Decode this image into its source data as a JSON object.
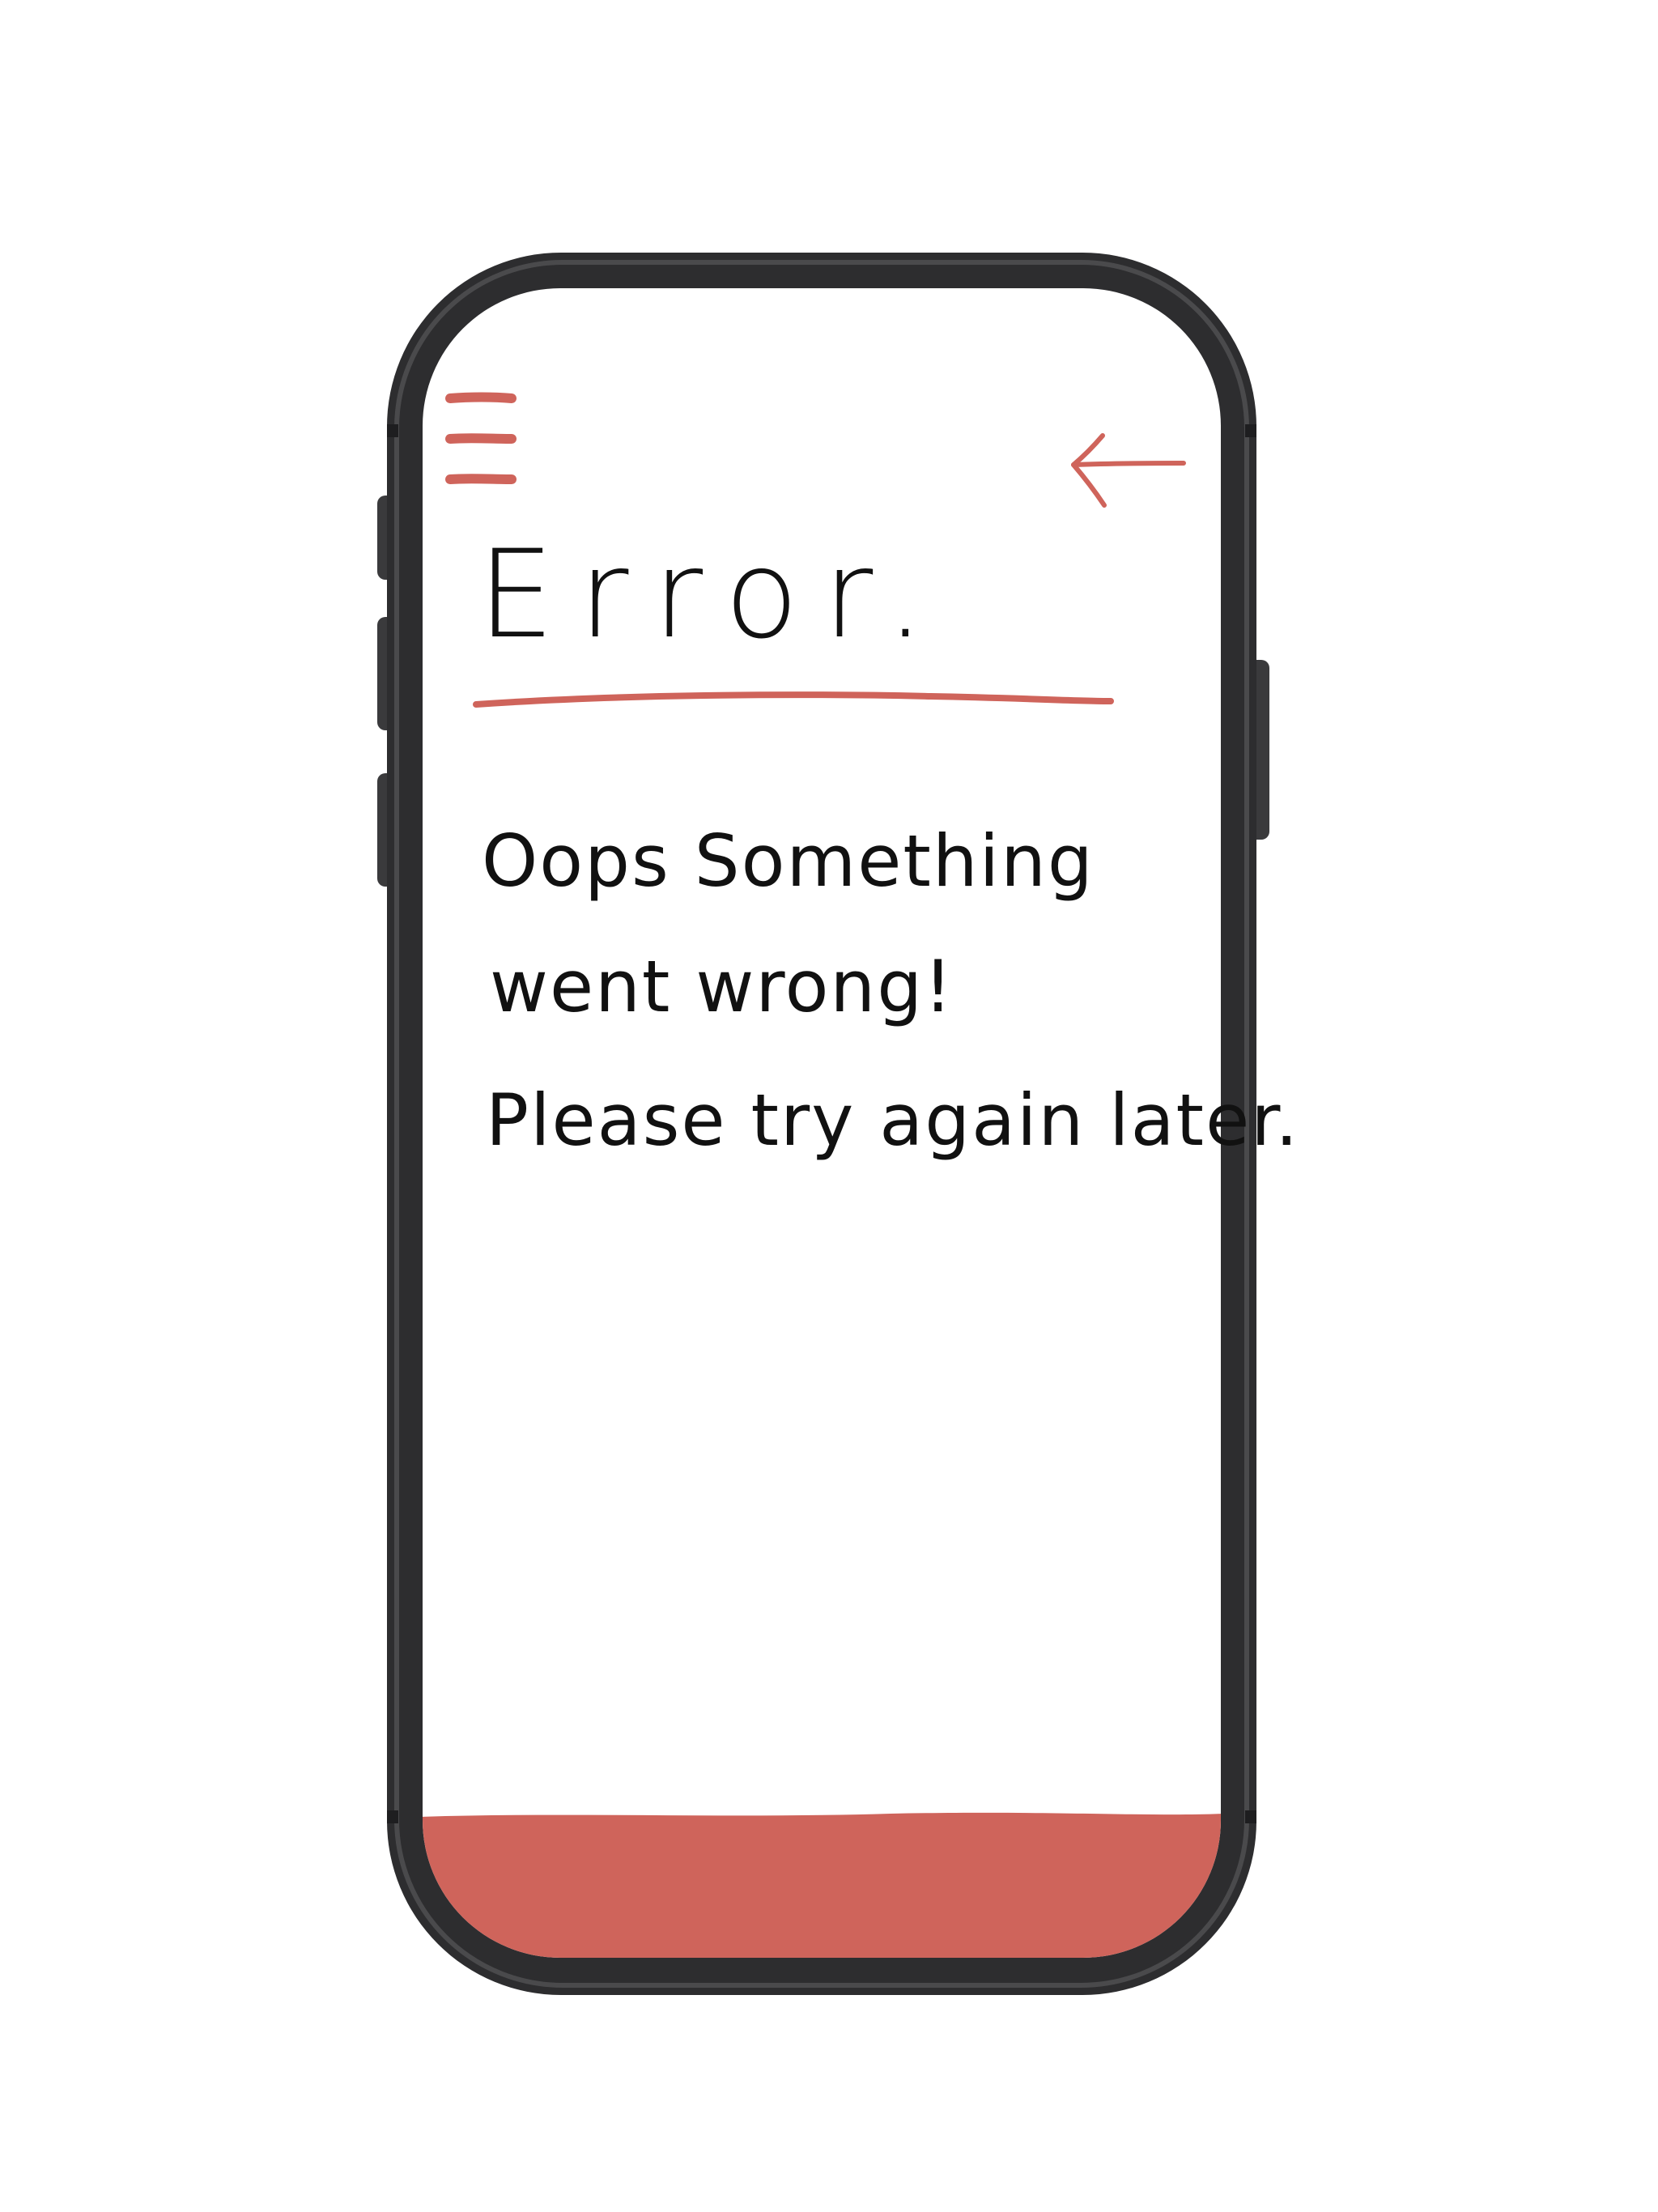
{
  "colors": {
    "accent": "#cf645b",
    "frame": "#3a3a3c",
    "frame_outer": "#2d2d2f",
    "screen": "#ffffff",
    "ink": "#111111"
  },
  "header": {
    "menu_icon": "hamburger-menu-icon",
    "back_icon": "arrow-left-icon"
  },
  "content": {
    "title": "Error.",
    "message_line1": "Oops Something",
    "message_line2": "went wrong!",
    "message_line3": "Please try again later."
  },
  "footer": {
    "bar_color": "#cf645b"
  }
}
